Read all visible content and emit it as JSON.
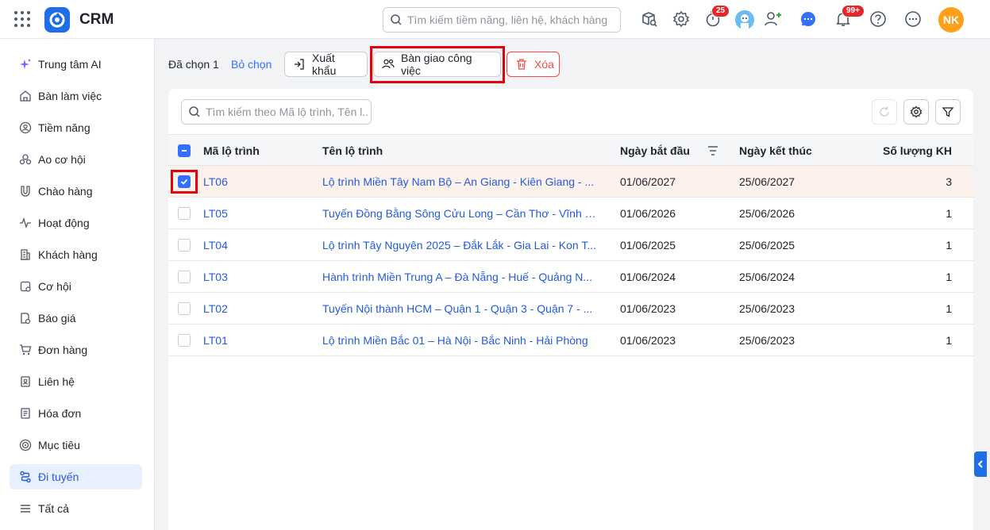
{
  "header": {
    "app_title": "CRM",
    "search_placeholder": "Tìm kiếm tiềm năng, liên hệ, khách hàng",
    "timer_badge": "25",
    "notifications_badge": "99+",
    "user_initials": "NK",
    "colors": {
      "brand": "#1e6fe6",
      "avatar": "#ff9f1a",
      "badge": "#e5262b"
    }
  },
  "sidebar": {
    "items": [
      {
        "label": "Trung tâm AI",
        "icon": "sparkle-icon"
      },
      {
        "label": "Bàn làm việc",
        "icon": "home-icon"
      },
      {
        "label": "Tiềm năng",
        "icon": "target-person-icon"
      },
      {
        "label": "Ao cơ hội",
        "icon": "people-pool-icon"
      },
      {
        "label": "Chào hàng",
        "icon": "magnet-icon"
      },
      {
        "label": "Hoạt động",
        "icon": "activity-icon"
      },
      {
        "label": "Khách hàng",
        "icon": "building-icon"
      },
      {
        "label": "Cơ hội",
        "icon": "opportunity-icon"
      },
      {
        "label": "Báo giá",
        "icon": "quote-icon"
      },
      {
        "label": "Đơn hàng",
        "icon": "cart-icon"
      },
      {
        "label": "Liên hệ",
        "icon": "contact-book-icon"
      },
      {
        "label": "Hóa đơn",
        "icon": "invoice-icon"
      },
      {
        "label": "Mục tiêu",
        "icon": "goal-icon"
      },
      {
        "label": "Đi tuyến",
        "icon": "route-icon"
      },
      {
        "label": "Tất cả",
        "icon": "menu-icon"
      }
    ],
    "active_index": 13,
    "active_color": "#245bdb"
  },
  "actions": {
    "selected_label": "Đã chọn 1",
    "deselect_label": "Bỏ chọn",
    "export_label": "Xuất khẩu",
    "handover_label": "Bàn giao công việc",
    "delete_label": "Xóa"
  },
  "table": {
    "search_placeholder": "Tìm kiếm theo Mã lộ trình, Tên l...",
    "columns": [
      "Mã lộ trình",
      "Tên lộ trình",
      "Ngày bắt đầu",
      "Ngày kết thúc",
      "Số lượng KH"
    ],
    "rows": [
      {
        "code": "LT06",
        "name": "Lộ trình Miền Tây Nam Bộ – An Giang - Kiên Giang - ...",
        "start": "01/06/2027",
        "end": "25/06/2027",
        "count": "3",
        "selected": true
      },
      {
        "code": "LT05",
        "name": "Tuyến Đồng Bằng Sông Cửu Long – Cần Thơ - Vĩnh L...",
        "start": "01/06/2026",
        "end": "25/06/2026",
        "count": "1",
        "selected": false
      },
      {
        "code": "LT04",
        "name": "Lộ trình Tây Nguyên 2025 – Đắk Lắk - Gia Lai - Kon T...",
        "start": "01/06/2025",
        "end": "25/06/2025",
        "count": "1",
        "selected": false
      },
      {
        "code": "LT03",
        "name": "Hành trình Miền Trung A – Đà Nẵng - Huế - Quảng N...",
        "start": "01/06/2024",
        "end": "25/06/2024",
        "count": "1",
        "selected": false
      },
      {
        "code": "LT02",
        "name": "Tuyến Nội thành HCM – Quận 1 - Quận 3 - Quận 7 - ...",
        "start": "01/06/2023",
        "end": "25/06/2023",
        "count": "1",
        "selected": false
      },
      {
        "code": "LT01",
        "name": "Lộ trình Miền Bắc 01 – Hà Nội - Bắc Ninh - Hải Phòng",
        "start": "01/06/2023",
        "end": "25/06/2023",
        "count": "1",
        "selected": false
      }
    ],
    "colors": {
      "link": "#245bdb",
      "selected_row": "#fdf1ec",
      "checkbox": "#3370ff"
    }
  }
}
